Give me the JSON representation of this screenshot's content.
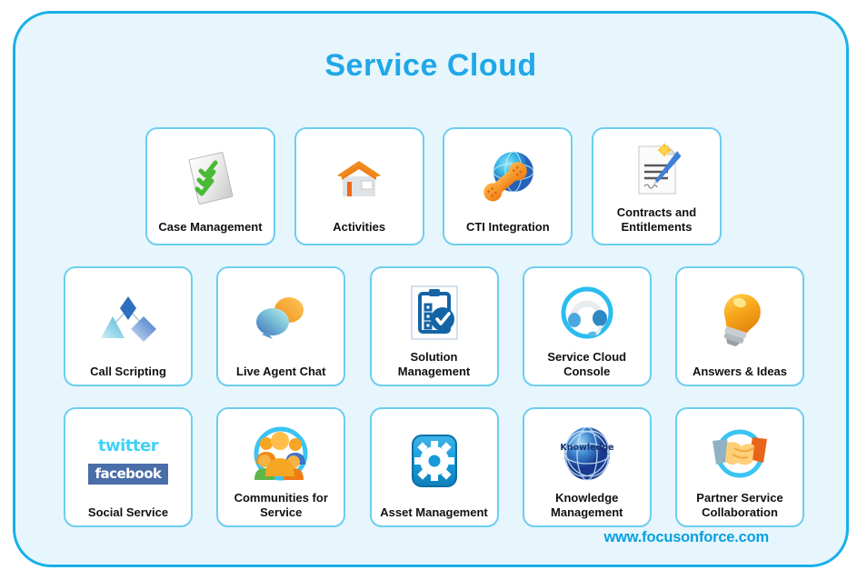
{
  "title": "Service Cloud",
  "footer": {
    "url": "www.focusonforce.com"
  },
  "colors": {
    "panel_background": "#e6f6fc",
    "panel_border": "#19b0e8",
    "title_text": "#20a7e8",
    "card_background": "#ffffff",
    "card_border": "#6ecdf0",
    "label_text": "#111111",
    "footer_text": "#0a9fe0",
    "accent_orange": "#f5a623",
    "accent_blue": "#1e88c7",
    "accent_green": "#4ab94a"
  },
  "rows": [
    {
      "row_index": 1,
      "cards": [
        {
          "label": "Case Management",
          "icon": "checklist-document-icon"
        },
        {
          "label": "Activities",
          "icon": "house-icon"
        },
        {
          "label": "CTI Integration",
          "icon": "phone-globe-icon"
        },
        {
          "label": "Contracts and\nEntitlements",
          "icon": "contract-pen-icon"
        }
      ]
    },
    {
      "row_index": 2,
      "cards": [
        {
          "label": "Call Scripting",
          "icon": "shapes-flow-icon"
        },
        {
          "label": "Live Agent Chat",
          "icon": "speech-bubbles-icon"
        },
        {
          "label": "Solution\nManagement",
          "icon": "clipboard-check-icon"
        },
        {
          "label": "Service Cloud\nConsole",
          "icon": "headset-icon"
        },
        {
          "label": "Answers & Ideas",
          "icon": "lightbulb-icon"
        }
      ]
    },
    {
      "row_index": 3,
      "cards": [
        {
          "label": "Social Service",
          "icon": "social-logos-icon",
          "logos": {
            "twitter": "twitter",
            "facebook": "facebook"
          }
        },
        {
          "label": "Communities for\nService",
          "icon": "people-group-icon"
        },
        {
          "label": "Asset Management",
          "icon": "gear-icon"
        },
        {
          "label": "Knowledge\nManagement",
          "icon": "knowledge-globe-icon",
          "globe_text": "Knowledge"
        },
        {
          "label": "Partner Service\nCollaboration",
          "icon": "handshake-icon"
        }
      ]
    }
  ]
}
